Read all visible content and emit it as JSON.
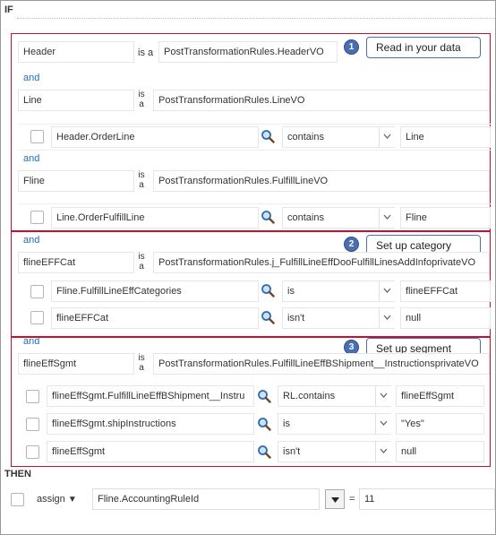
{
  "if_label": "IF",
  "then_label": "THEN",
  "and_label": "and",
  "isa_label": "is a",
  "isa2_top": "is",
  "isa2_bottom": "a",
  "callouts": [
    {
      "num": "1",
      "text": "Read in your data"
    },
    {
      "num": "2",
      "text": "Set up category"
    },
    {
      "num": "3",
      "text": "Set up segment"
    }
  ],
  "vars": {
    "header": {
      "name": "Header",
      "type": "PostTransformationRules.HeaderVO"
    },
    "line": {
      "name": "Line",
      "type": "PostTransformationRules.LineVO"
    },
    "fline": {
      "name": "Fline",
      "type": "PostTransformationRules.FulfillLineVO"
    },
    "flineEFFCat": {
      "name": "flineEFFCat",
      "type": "PostTransformationRules.j_FulfillLineEffDooFulfillLinesAddInfoprivateVO"
    },
    "flineEffSgmt": {
      "name": "flineEffSgmt",
      "type": "PostTransformationRules.FulfillLineEffBShipment__InstructionsprivateVO"
    }
  },
  "conditions": {
    "c1": {
      "left": "Header.OrderLine",
      "op": "contains",
      "right": "Line"
    },
    "c2": {
      "left": "Line.OrderFulfillLine",
      "op": "contains",
      "right": "Fline"
    },
    "c3": {
      "left": "Fline.FulfillLineEffCategories",
      "op": "is",
      "right": "flineEFFCat"
    },
    "c4": {
      "left": "flineEFFCat",
      "op": "isn't",
      "right": "null"
    },
    "c5": {
      "left": "flineEffSgmt.FulfillLineEffBShipment__Instru",
      "op": "RL.contains",
      "right": "flineEffSgmt"
    },
    "c6": {
      "left": "flineEffSgmt.shipInstructions",
      "op": "is",
      "right": "\"Yes\""
    },
    "c7": {
      "left": "flineEffSgmt",
      "op": "isn't",
      "right": "null"
    }
  },
  "then": {
    "action": "assign",
    "target": "Fline.AccountingRuleId",
    "equals": "=",
    "value": "11"
  },
  "colors": {
    "red_border": "#c8102e",
    "and_blue": "#1f6fb2",
    "callout_blue": "#4a6fb0"
  }
}
